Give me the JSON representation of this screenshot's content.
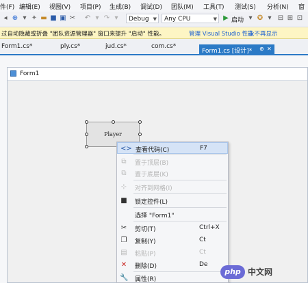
{
  "menubar": {
    "items": [
      "件(F)",
      "编辑(E)",
      "视图(V)",
      "项目(P)",
      "生成(B)",
      "调试(D)",
      "团队(M)",
      "工具(T)",
      "测试(S)",
      "分析(N)",
      "窗"
    ]
  },
  "toolbar": {
    "config": "Debug",
    "platform": "Any CPU",
    "start_label": "启动"
  },
  "infobar": {
    "text": "过自动隐藏或折叠 \"团队资源管理器\" 窗口来提升 \"启动\" 性能。",
    "link1": "管理 Visual Studio 性能",
    "link2": "永不再显示"
  },
  "tabs": {
    "items": [
      "Form1.cs*",
      "ply.cs*",
      "jud.cs*",
      "com.cs*"
    ],
    "active": "Form1.cs [设计]*"
  },
  "form": {
    "title": "Form1",
    "button_text": "Player"
  },
  "context_menu": {
    "items": [
      {
        "label": "查看代码(C)",
        "shortcut": "F7",
        "icon": "code-icon"
      },
      {
        "label": "置于顶层(B)",
        "shortcut": "",
        "icon": "bring-front-icon"
      },
      {
        "label": "置于底层(K)",
        "shortcut": "",
        "icon": "send-back-icon"
      },
      {
        "label": "对齐到网格(I)",
        "shortcut": "",
        "icon": "grid-icon"
      },
      {
        "label": "锁定控件(L)",
        "shortcut": "",
        "icon": "lock-icon"
      },
      {
        "label": "选择 \"Form1\"",
        "shortcut": "",
        "icon": ""
      },
      {
        "label": "剪切(T)",
        "shortcut": "Ctrl+X",
        "icon": "scissors-icon"
      },
      {
        "label": "复制(Y)",
        "shortcut": "Ct",
        "icon": "copy-icon"
      },
      {
        "label": "粘贴(P)",
        "shortcut": "Ct",
        "icon": "paste-icon"
      },
      {
        "label": "删除(D)",
        "shortcut": "De",
        "icon": "delete-icon"
      },
      {
        "label": "属性(R)",
        "shortcut": "",
        "icon": "wrench-icon"
      }
    ]
  },
  "watermark": {
    "logo": "php",
    "text": "中文网"
  },
  "colors": {
    "accent": "#2b7ac6",
    "infobar": "#fdf5c4",
    "highlight": "#d5e3f6"
  }
}
